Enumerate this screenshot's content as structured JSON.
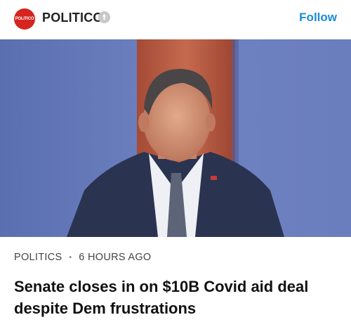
{
  "header": {
    "logo_text": "POLITICO",
    "publisher": "POLITICO",
    "follow_label": "Follow",
    "accent_color": "#d6241f",
    "link_color": "#1a8cd8"
  },
  "article": {
    "image_alt": "photo",
    "category": "POLITICS",
    "separator": "•",
    "timestamp": "6 HOURS AGO",
    "headline": "Senate closes in on $10B Covid aid deal despite Dem frustrations"
  }
}
